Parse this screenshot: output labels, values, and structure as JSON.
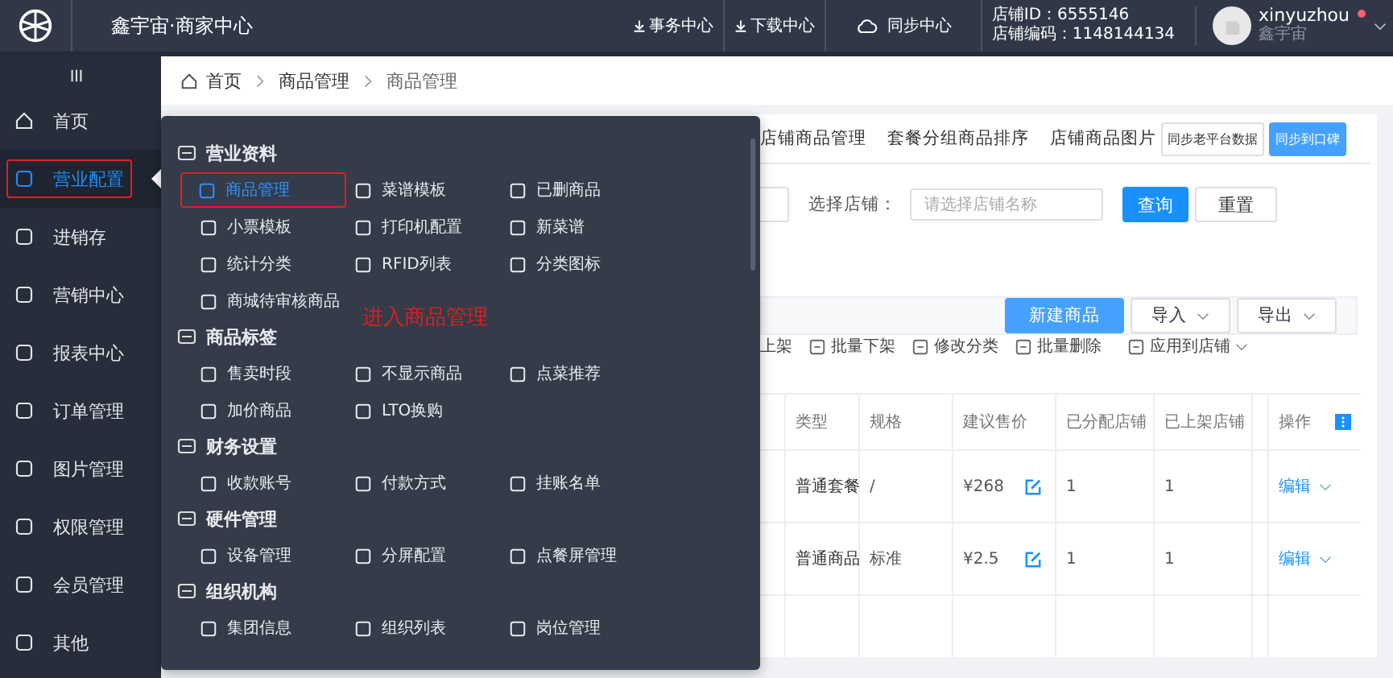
{
  "app": {
    "title": "鑫宇宙·商家中心"
  },
  "header_links": [
    {
      "label": "事务中心",
      "kind": "arrow"
    },
    {
      "label": "下载中心",
      "kind": "arrow"
    },
    {
      "label": "同步中心",
      "kind": "cloud"
    }
  ],
  "store": {
    "id_line": "店铺ID：6555146",
    "code_line": "店铺编码：1148144134"
  },
  "user": {
    "name": "xinyuzhou",
    "org": "鑫宇宙",
    "notification": true
  },
  "sidebar": {
    "items": [
      {
        "label": "首页",
        "selected": false,
        "highlighted": false
      },
      {
        "label": "营业配置",
        "selected": true,
        "highlighted": true
      },
      {
        "label": "进销存",
        "selected": false,
        "highlighted": false
      },
      {
        "label": "营销中心",
        "selected": false,
        "highlighted": false
      },
      {
        "label": "报表中心",
        "selected": false,
        "highlighted": false
      },
      {
        "label": "订单管理",
        "selected": false,
        "highlighted": false
      },
      {
        "label": "图片管理",
        "selected": false,
        "highlighted": false
      },
      {
        "label": "权限管理",
        "selected": false,
        "highlighted": false
      },
      {
        "label": "会员管理",
        "selected": false,
        "highlighted": false
      },
      {
        "label": "其他",
        "selected": false,
        "highlighted": false
      }
    ]
  },
  "breadcrumb": [
    "首页",
    "商品管理",
    "商品管理"
  ],
  "tabs": [
    {
      "label": "店铺商品管理",
      "selected": false
    },
    {
      "label": "套餐分组商品排序",
      "selected": false
    },
    {
      "label": "店铺商品图片",
      "selected": false
    }
  ],
  "tab_buttons": [
    {
      "label": "同步老平台数据",
      "kind": "outline"
    },
    {
      "label": "同步到口碑",
      "kind": "primary"
    }
  ],
  "filter": {
    "label": "选择店铺：",
    "placeholder": "请选择店铺名称",
    "buttons": [
      {
        "label": "查询",
        "kind": "primary"
      },
      {
        "label": "重置",
        "kind": "default"
      }
    ]
  },
  "toolbar_buttons": [
    {
      "label": "新建商品",
      "kind": "primary",
      "dropdown": false
    },
    {
      "label": "导入",
      "kind": "default",
      "dropdown": true
    },
    {
      "label": "导出",
      "kind": "default",
      "dropdown": true
    }
  ],
  "batch_actions": [
    {
      "label": "上架",
      "dropdown": false
    },
    {
      "label": "批量下架",
      "dropdown": false
    },
    {
      "label": "修改分类",
      "dropdown": false
    },
    {
      "label": "批量删除",
      "dropdown": false
    },
    {
      "label": "应用到店铺",
      "dropdown": true
    }
  ],
  "table": {
    "columns": [
      "类型",
      "规格",
      "建议售价",
      "已分配店铺",
      "已上架店铺",
      "操作"
    ],
    "rows": [
      {
        "type": "普通套餐",
        "spec": "/",
        "price": "¥268",
        "assigned": "1",
        "listed": "1",
        "action": "编辑"
      },
      {
        "type": "普通商品",
        "spec": "标准",
        "price": "¥2.5",
        "assigned": "1",
        "listed": "1",
        "action": "编辑"
      }
    ]
  },
  "menu": {
    "annotation": "进入商品管理",
    "sections": [
      {
        "title": "营业资料",
        "items": [
          {
            "label": "商品管理",
            "selected": true,
            "highlighted": true
          },
          {
            "label": "菜谱模板",
            "selected": false,
            "highlighted": false
          },
          {
            "label": "已删商品",
            "selected": false,
            "highlighted": false
          },
          {
            "label": "小票模板",
            "selected": false,
            "highlighted": false
          },
          {
            "label": "打印机配置",
            "selected": false,
            "highlighted": false
          },
          {
            "label": "新菜谱",
            "selected": false,
            "highlighted": false
          },
          {
            "label": "统计分类",
            "selected": false,
            "highlighted": false
          },
          {
            "label": "RFID列表",
            "selected": false,
            "highlighted": false
          },
          {
            "label": "分类图标",
            "selected": false,
            "highlighted": false
          },
          {
            "label": "商城待审核商品",
            "selected": false,
            "highlighted": false
          }
        ]
      },
      {
        "title": "商品标签",
        "items": [
          {
            "label": "售卖时段",
            "selected": false,
            "highlighted": false
          },
          {
            "label": "不显示商品",
            "selected": false,
            "highlighted": false
          },
          {
            "label": "点菜推荐",
            "selected": false,
            "highlighted": false
          },
          {
            "label": "加价商品",
            "selected": false,
            "highlighted": false
          },
          {
            "label": "LTO换购",
            "selected": false,
            "highlighted": false
          }
        ]
      },
      {
        "title": "财务设置",
        "items": [
          {
            "label": "收款账号",
            "selected": false,
            "highlighted": false
          },
          {
            "label": "付款方式",
            "selected": false,
            "highlighted": false
          },
          {
            "label": "挂账名单",
            "selected": false,
            "highlighted": false
          }
        ]
      },
      {
        "title": "硬件管理",
        "items": [
          {
            "label": "设备管理",
            "selected": false,
            "highlighted": false
          },
          {
            "label": "分屏配置",
            "selected": false,
            "highlighted": false
          },
          {
            "label": "点餐屏管理",
            "selected": false,
            "highlighted": false
          }
        ]
      },
      {
        "title": "组织机构",
        "items": [
          {
            "label": "集团信息",
            "selected": false,
            "highlighted": false
          },
          {
            "label": "组织列表",
            "selected": false,
            "highlighted": false
          },
          {
            "label": "岗位管理",
            "selected": false,
            "highlighted": false
          }
        ]
      }
    ]
  }
}
